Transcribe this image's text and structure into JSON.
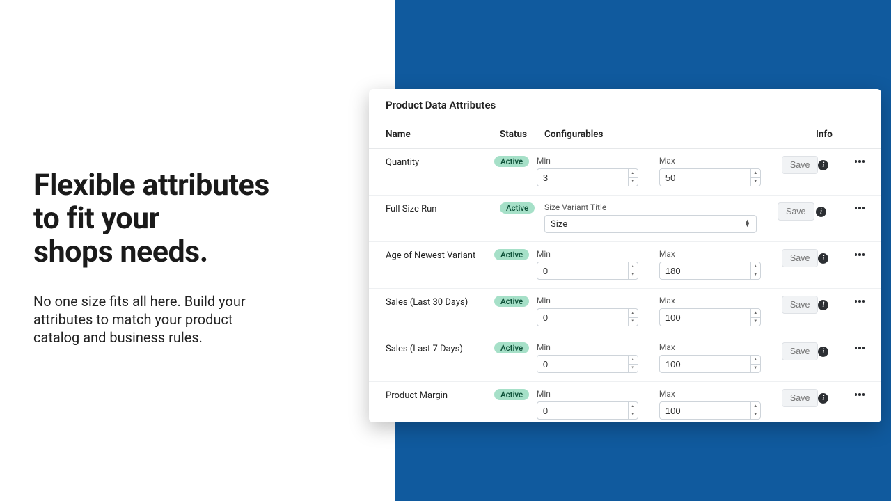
{
  "marketing": {
    "headline_l1": "Flexible attributes",
    "headline_l2": "to fit your",
    "headline_l3": "shops needs.",
    "body": "No one size fits all here. Build your attributes to match your product catalog and business rules."
  },
  "panel": {
    "title": "Product Data Attributes",
    "columns": {
      "name": "Name",
      "status": "Status",
      "config": "Configurables",
      "info": "Info"
    },
    "labels": {
      "min": "Min",
      "max": "Max",
      "size_variant_title": "Size Variant Title",
      "save": "Save"
    },
    "status_active": "Active",
    "select_value": "Size",
    "rows": [
      {
        "name": "Quantity",
        "type": "minmax",
        "min": "3",
        "max": "50"
      },
      {
        "name": "Full Size Run",
        "type": "select"
      },
      {
        "name": "Age of Newest Variant",
        "type": "minmax",
        "min": "0",
        "max": "180"
      },
      {
        "name": "Sales (Last 30 Days)",
        "type": "minmax",
        "min": "0",
        "max": "100"
      },
      {
        "name": "Sales (Last 7 Days)",
        "type": "minmax",
        "min": "0",
        "max": "100"
      },
      {
        "name": "Product Margin",
        "type": "minmax",
        "min": "0",
        "max": "100"
      }
    ]
  }
}
